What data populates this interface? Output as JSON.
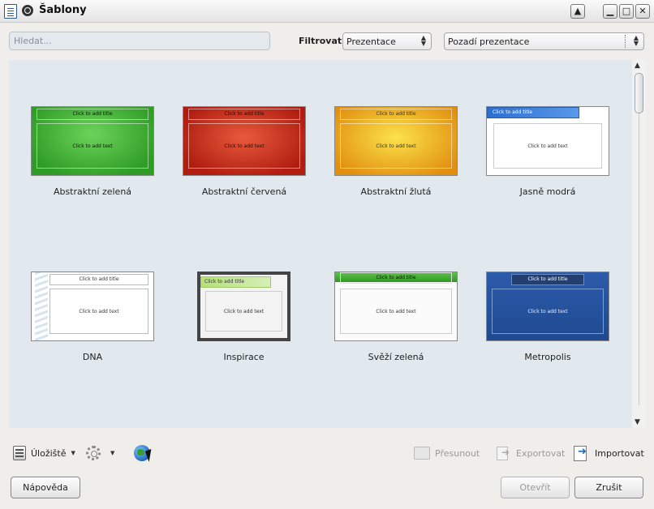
{
  "window": {
    "title": "Šablony",
    "controls": {
      "shade": "▲",
      "minimize": "▁",
      "maximize": "□",
      "close": "✕"
    }
  },
  "search": {
    "placeholder": "Hledat..."
  },
  "filter": {
    "label": "Filtrovat",
    "type_value": "Prezentace",
    "category_value": "Pozadí prezentace"
  },
  "templates": [
    {
      "name": "Abstraktní zelená",
      "title_text": "Click to add title",
      "body_text": "Click to add text",
      "style": "green"
    },
    {
      "name": "Abstraktní červená",
      "title_text": "Click to add title",
      "body_text": "Click to add text",
      "style": "red"
    },
    {
      "name": "Abstraktní žlutá",
      "title_text": "Click to add title",
      "body_text": "Click to add text",
      "style": "yellow"
    },
    {
      "name": "Jasně modrá",
      "title_text": "Click to add title",
      "body_text": "Click to add text",
      "style": "blue"
    },
    {
      "name": "DNA",
      "title_text": "Click to add title",
      "body_text": "Click to add text",
      "style": "dna"
    },
    {
      "name": "Inspirace",
      "title_text": "Click to add title",
      "body_text": "Click to add text",
      "style": "insp"
    },
    {
      "name": "Svěží zelená",
      "title_text": "Click to add title",
      "body_text": "Click to add text",
      "style": "fresh"
    },
    {
      "name": "Metropolis",
      "title_text": "Click to add title",
      "body_text": "Click to add text",
      "style": "metro"
    }
  ],
  "toolbar": {
    "storage_label": "Úložiště",
    "move_label": "Přesunout",
    "export_label": "Exportovat",
    "import_label": "Importovat",
    "icons": [
      "storage-icon",
      "settings-gear-icon",
      "online-globe-icon",
      "move-icon",
      "export-icon",
      "import-icon"
    ]
  },
  "buttons": {
    "help": "Nápověda",
    "open": "Otevřít",
    "cancel": "Zrušit"
  }
}
